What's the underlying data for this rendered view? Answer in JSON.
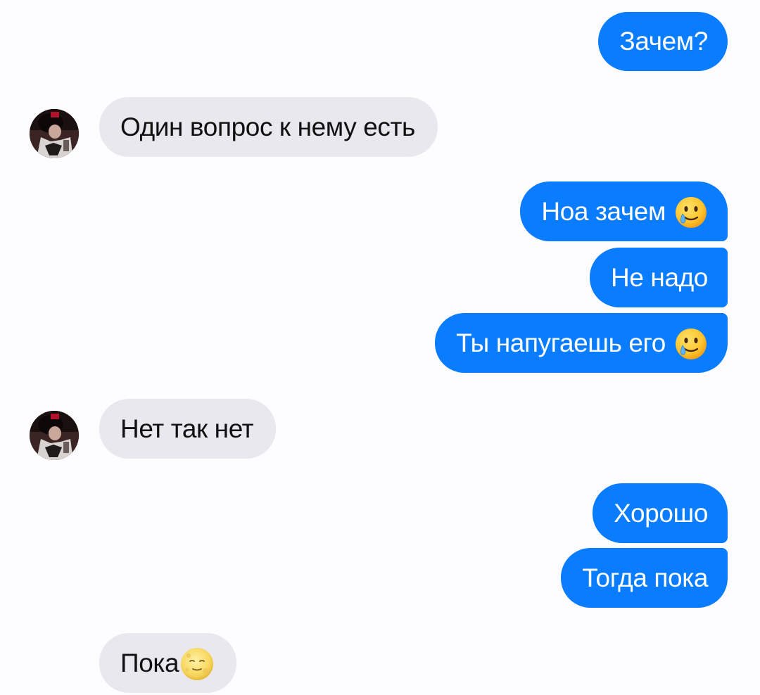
{
  "conversation": {
    "messages": [
      {
        "direction": "outgoing",
        "text": "Зачем?"
      },
      {
        "direction": "incoming",
        "text": "Один вопрос к нему есть"
      },
      {
        "direction": "outgoing",
        "text": "Ноа зачем",
        "emoji": "smiling-face-with-tear"
      },
      {
        "direction": "outgoing",
        "text": "Не надо"
      },
      {
        "direction": "outgoing",
        "text": "Ты напугаешь его",
        "emoji": "smiling-face-with-tear"
      },
      {
        "direction": "incoming",
        "text": "Нет так нет"
      },
      {
        "direction": "outgoing",
        "text": "Хорошо"
      },
      {
        "direction": "outgoing",
        "text": "Тогда пока"
      },
      {
        "direction": "incoming",
        "text": "Пока",
        "emoji": "full-moon-face"
      }
    ]
  },
  "colors": {
    "outgoing_bubble": "#0a7cff",
    "incoming_bubble": "#e9e8ee",
    "background": "#fdfcfe"
  }
}
